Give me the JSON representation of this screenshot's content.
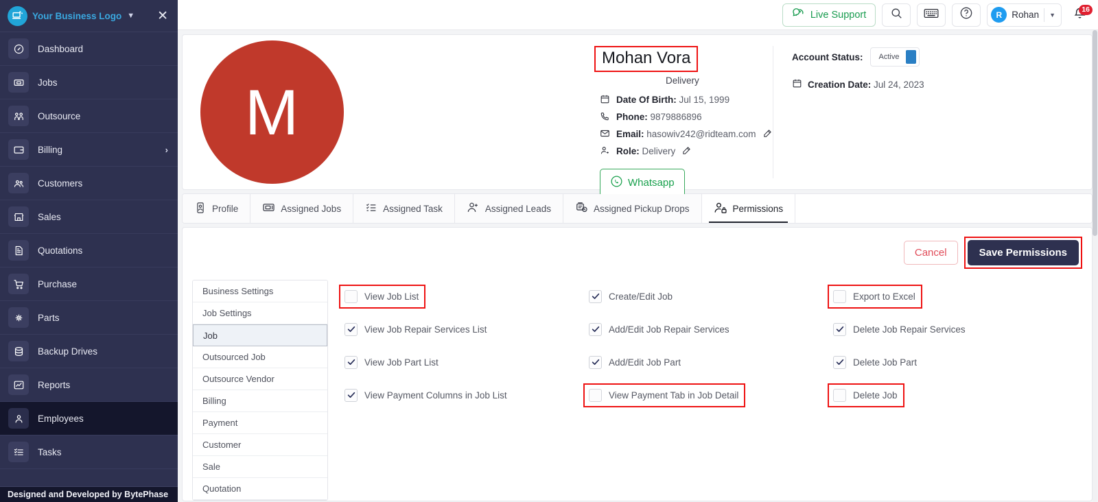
{
  "sidebar": {
    "brand": {
      "name": "Your Business Logo",
      "logo_icon": "laptop-logo-icon",
      "caret_icon": "chevron-down-icon",
      "close_icon": "close-icon"
    },
    "items": [
      {
        "label": "Dashboard",
        "icon": "dashboard-icon",
        "active": false,
        "has_arrow": false
      },
      {
        "label": "Jobs",
        "icon": "jobs-icon",
        "active": false,
        "has_arrow": false
      },
      {
        "label": "Outsource",
        "icon": "outsource-icon",
        "active": false,
        "has_arrow": false
      },
      {
        "label": "Billing",
        "icon": "billing-icon",
        "active": false,
        "has_arrow": true
      },
      {
        "label": "Customers",
        "icon": "customers-icon",
        "active": false,
        "has_arrow": false
      },
      {
        "label": "Sales",
        "icon": "sales-icon",
        "active": false,
        "has_arrow": false
      },
      {
        "label": "Quotations",
        "icon": "quotations-icon",
        "active": false,
        "has_arrow": false
      },
      {
        "label": "Purchase",
        "icon": "purchase-icon",
        "active": false,
        "has_arrow": false
      },
      {
        "label": "Parts",
        "icon": "parts-icon",
        "active": false,
        "has_arrow": false
      },
      {
        "label": "Backup Drives",
        "icon": "backup-drives-icon",
        "active": false,
        "has_arrow": false
      },
      {
        "label": "Reports",
        "icon": "reports-icon",
        "active": false,
        "has_arrow": false
      },
      {
        "label": "Employees",
        "icon": "employees-icon",
        "active": true,
        "has_arrow": false
      },
      {
        "label": "Tasks",
        "icon": "tasks-icon",
        "active": false,
        "has_arrow": false
      }
    ],
    "footer": "Designed and Developed by BytePhase"
  },
  "topbar": {
    "live_support_label": "Live Support",
    "live_support_icon": "chat-bubbles-icon",
    "search_icon": "search-icon",
    "keyboard_icon": "keyboard-icon",
    "help_icon": "question-circle-icon",
    "user_initial": "R",
    "user_name": "Rohan",
    "user_caret_icon": "chevron-down-icon",
    "bell_icon": "bell-icon",
    "notification_count": "16"
  },
  "profile": {
    "avatar_initial": "M",
    "avatar_color": "#c0392b",
    "name": "Mohan Vora",
    "role_subtitle": "Delivery",
    "fields": [
      {
        "icon": "calendar-icon",
        "label": "Date Of Birth:",
        "value": "Jul 15, 1999",
        "editable": false
      },
      {
        "icon": "phone-icon",
        "label": "Phone:",
        "value": "9879886896",
        "editable": false
      },
      {
        "icon": "mail-icon",
        "label": "Email:",
        "value": "hasowiv242@ridteam.com",
        "editable": true
      },
      {
        "icon": "user-tag-icon",
        "label": "Role:",
        "value": "Delivery",
        "editable": true
      }
    ],
    "whatsapp_label": "Whatsapp",
    "whatsapp_icon": "whatsapp-icon",
    "account_status_label": "Account Status:",
    "account_status_value": "Active",
    "creation_date_label": "Creation Date:",
    "creation_date_value": "Jul 24, 2023",
    "creation_date_icon": "calendar-icon"
  },
  "tabs": [
    {
      "label": "Profile",
      "icon": "id-card-icon",
      "active": false
    },
    {
      "label": "Assigned Jobs",
      "icon": "jobs-box-icon",
      "active": false
    },
    {
      "label": "Assigned Task",
      "icon": "checklist-icon",
      "active": false
    },
    {
      "label": "Assigned Leads",
      "icon": "user-plus-icon",
      "active": false
    },
    {
      "label": "Assigned Pickup Drops",
      "icon": "pickup-clock-icon",
      "active": false
    },
    {
      "label": "Permissions",
      "icon": "user-lock-icon",
      "active": true
    }
  ],
  "permissions": {
    "cancel_label": "Cancel",
    "save_label": "Save Permissions",
    "categories": [
      {
        "label": "Business Settings",
        "active": false
      },
      {
        "label": "Job Settings",
        "active": false
      },
      {
        "label": "Job",
        "active": true
      },
      {
        "label": "Outsourced Job",
        "active": false
      },
      {
        "label": "Outsource Vendor",
        "active": false
      },
      {
        "label": "Billing",
        "active": false
      },
      {
        "label": "Payment",
        "active": false
      },
      {
        "label": "Customer",
        "active": false
      },
      {
        "label": "Sale",
        "active": false
      },
      {
        "label": "Quotation",
        "active": false
      }
    ],
    "rows": [
      [
        {
          "label": "View Job List",
          "checked": false,
          "highlighted": true
        },
        {
          "label": "Create/Edit Job",
          "checked": true,
          "highlighted": false
        },
        {
          "label": "Export to Excel",
          "checked": false,
          "highlighted": true
        }
      ],
      [
        {
          "label": "View Job Repair Services List",
          "checked": true,
          "highlighted": false
        },
        {
          "label": "Add/Edit Job Repair Services",
          "checked": true,
          "highlighted": false
        },
        {
          "label": "Delete Job Repair Services",
          "checked": true,
          "highlighted": false
        }
      ],
      [
        {
          "label": "View Job Part List",
          "checked": true,
          "highlighted": false
        },
        {
          "label": "Add/Edit Job Part",
          "checked": true,
          "highlighted": false
        },
        {
          "label": "Delete Job Part",
          "checked": true,
          "highlighted": false
        }
      ],
      [
        {
          "label": "View Payment Columns in Job List",
          "checked": true,
          "highlighted": false
        },
        {
          "label": "View Payment Tab in Job Detail",
          "checked": false,
          "highlighted": true
        },
        {
          "label": "Delete Job",
          "checked": false,
          "highlighted": true
        }
      ]
    ]
  }
}
